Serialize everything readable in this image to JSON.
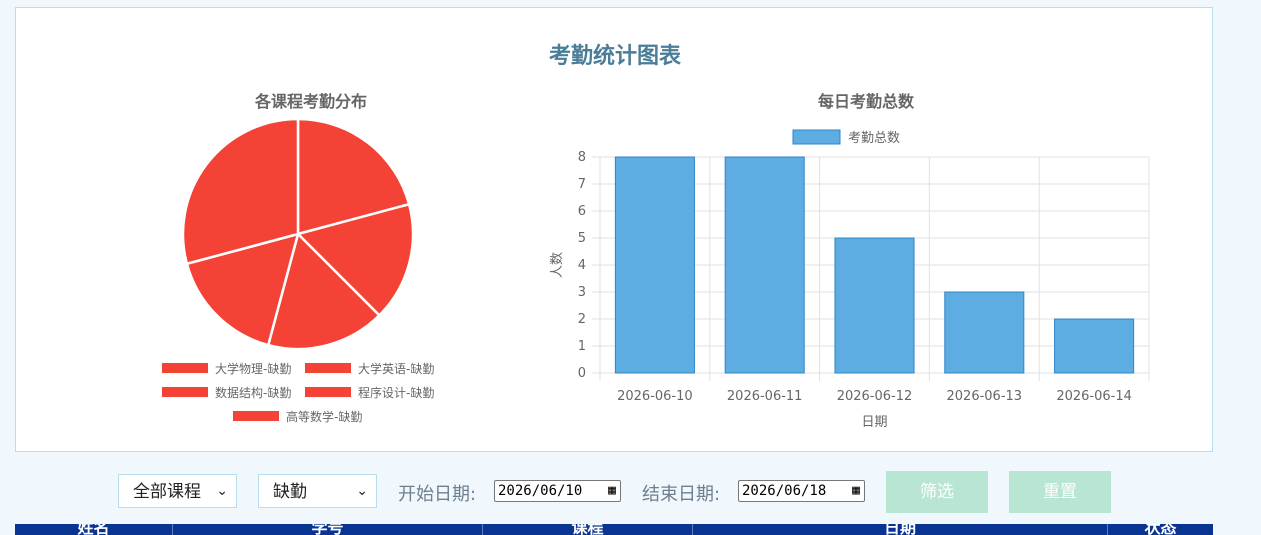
{
  "page": {
    "title": "考勤统计图表"
  },
  "chart_data": [
    {
      "type": "pie",
      "title": "各课程考勤分布",
      "labels": [
        "大学物理-缺勤",
        "大学英语-缺勤",
        "数据结构-缺勤",
        "程序设计-缺勤",
        "高等数学-缺勤"
      ],
      "values": [
        5,
        4,
        4,
        4,
        7
      ],
      "color": "#f44336",
      "legend_position": "bottom"
    },
    {
      "type": "bar",
      "title": "每日考勤总数",
      "categories": [
        "2026-06-10",
        "2026-06-11",
        "2026-06-12",
        "2026-06-13",
        "2026-06-14"
      ],
      "series": [
        {
          "name": "考勤总数",
          "values": [
            8,
            8,
            5,
            3,
            2
          ],
          "color": "#5dade2"
        }
      ],
      "xlabel": "日期",
      "ylabel": "人数",
      "ylim": [
        0,
        8
      ],
      "yticks": [
        "0",
        "1",
        "2",
        "3",
        "4",
        "5",
        "6",
        "7",
        "8"
      ],
      "grid": true,
      "legend_position": "top"
    }
  ],
  "filters": {
    "course_select": "全部课程",
    "status_select": "缺勤",
    "start_label": "开始日期:",
    "start_value": "2026/06/10",
    "end_label": "结束日期:",
    "end_value": "2026/06/18",
    "filter_button": "筛选",
    "reset_button": "重置"
  },
  "table": {
    "headers": [
      "姓名",
      "学号",
      "课程",
      "日期",
      "状态"
    ]
  }
}
